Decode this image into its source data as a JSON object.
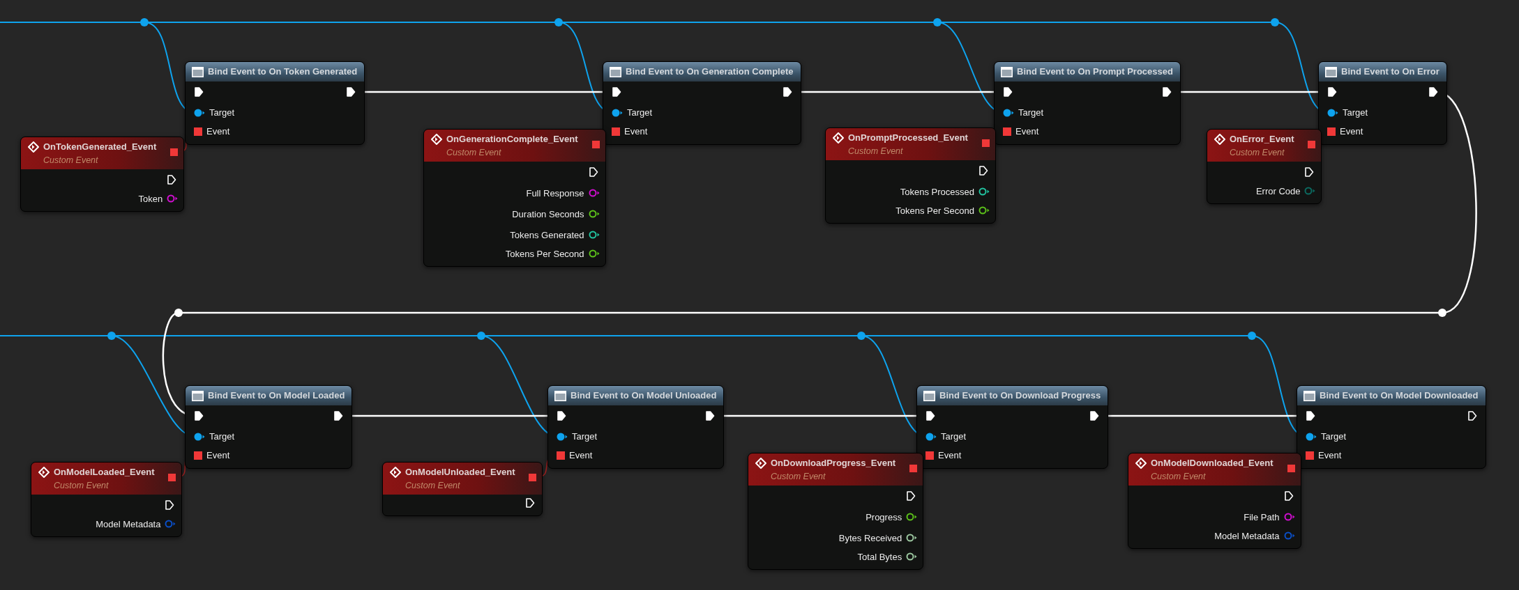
{
  "graph": {
    "bind_nodes": [
      {
        "title": "Bind Event to On Token Generated",
        "exec_in_connected": true,
        "exec_out_connected": true,
        "target_label": "Target",
        "event_label": "Event"
      },
      {
        "title": "Bind Event to On Generation Complete",
        "exec_in_connected": true,
        "exec_out_connected": true,
        "target_label": "Target",
        "event_label": "Event"
      },
      {
        "title": "Bind Event to On Prompt Processed",
        "exec_in_connected": true,
        "exec_out_connected": true,
        "target_label": "Target",
        "event_label": "Event"
      },
      {
        "title": "Bind Event to On Error",
        "exec_in_connected": true,
        "exec_out_connected": true,
        "target_label": "Target",
        "event_label": "Event"
      },
      {
        "title": "Bind Event to On Model Loaded",
        "exec_in_connected": true,
        "exec_out_connected": true,
        "target_label": "Target",
        "event_label": "Event"
      },
      {
        "title": "Bind Event to On Model Unloaded",
        "exec_in_connected": true,
        "exec_out_connected": true,
        "target_label": "Target",
        "event_label": "Event"
      },
      {
        "title": "Bind Event to On Download Progress",
        "exec_in_connected": true,
        "exec_out_connected": true,
        "target_label": "Target",
        "event_label": "Event"
      },
      {
        "title": "Bind Event to On Model Downloaded",
        "exec_in_connected": true,
        "exec_out_connected": false,
        "target_label": "Target",
        "event_label": "Event"
      }
    ],
    "event_nodes": [
      {
        "title": "OnTokenGenerated_Event",
        "subtitle": "Custom Event",
        "exec_connected": false,
        "outputs": [
          {
            "label": "Token",
            "color": "#d10ed1"
          }
        ]
      },
      {
        "title": "OnGenerationComplete_Event",
        "subtitle": "Custom Event",
        "exec_connected": false,
        "outputs": [
          {
            "label": "Full Response",
            "color": "#d10ed1"
          },
          {
            "label": "Duration Seconds",
            "color": "#5cc21a"
          },
          {
            "label": "Tokens Generated",
            "color": "#22c4a0"
          },
          {
            "label": "Tokens Per Second",
            "color": "#5cc21a"
          }
        ]
      },
      {
        "title": "OnPromptProcessed_Event",
        "subtitle": "Custom Event",
        "exec_connected": false,
        "outputs": [
          {
            "label": "Tokens Processed",
            "color": "#22c4a0"
          },
          {
            "label": "Tokens Per Second",
            "color": "#5cc21a"
          }
        ]
      },
      {
        "title": "OnError_Event",
        "subtitle": "Custom Event",
        "exec_connected": false,
        "outputs": [
          {
            "label": "Error Code",
            "color": "#0b6a60"
          }
        ]
      },
      {
        "title": "OnModelLoaded_Event",
        "subtitle": "Custom Event",
        "exec_connected": false,
        "outputs": [
          {
            "label": "Model Metadata",
            "color": "#0a4fc8"
          }
        ]
      },
      {
        "title": "OnModelUnloaded_Event",
        "subtitle": "Custom Event",
        "exec_connected": false
      },
      {
        "title": "OnDownloadProgress_Event",
        "subtitle": "Custom Event",
        "exec_connected": false,
        "outputs": [
          {
            "label": "Progress",
            "color": "#5cc21a"
          },
          {
            "label": "Bytes Received",
            "color": "#9cc8a0"
          },
          {
            "label": "Total Bytes",
            "color": "#9cc8a0"
          }
        ]
      },
      {
        "title": "OnModelDownloaded_Event",
        "subtitle": "Custom Event",
        "exec_connected": false,
        "outputs": [
          {
            "label": "File Path",
            "color": "#d10ed1"
          },
          {
            "label": "Model Metadata",
            "color": "#0a4fc8"
          }
        ]
      }
    ]
  }
}
